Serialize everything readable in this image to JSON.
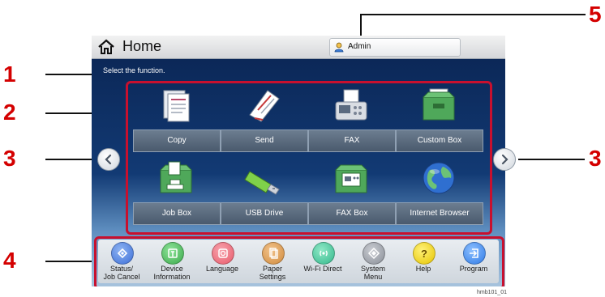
{
  "window": {
    "title": "Home"
  },
  "header": {
    "user_label": "Admin"
  },
  "prompt": "Select the function.",
  "functions": [
    {
      "label": "Copy",
      "icon": "copy-icon"
    },
    {
      "label": "Send",
      "icon": "send-icon"
    },
    {
      "label": "FAX",
      "icon": "fax-icon"
    },
    {
      "label": "Custom Box",
      "icon": "custom-box-icon"
    },
    {
      "label": "Job Box",
      "icon": "job-box-icon"
    },
    {
      "label": "USB Drive",
      "icon": "usb-drive-icon"
    },
    {
      "label": "FAX Box",
      "icon": "fax-box-icon"
    },
    {
      "label": "Internet Browser",
      "icon": "internet-browser-icon"
    }
  ],
  "system_menu": [
    {
      "line1": "Status/",
      "line2": "Job Cancel",
      "icon": "status-icon",
      "color": "#3d6fd8"
    },
    {
      "line1": "Device",
      "line2": "Information",
      "icon": "device-info-icon",
      "color": "#3aa94a"
    },
    {
      "line1": "Language",
      "line2": "",
      "icon": "language-icon",
      "color": "#e85a6a"
    },
    {
      "line1": "Paper",
      "line2": "Settings",
      "icon": "paper-settings-icon",
      "color": "#d08a3c"
    },
    {
      "line1": "Wi-Fi Direct",
      "line2": "",
      "icon": "wifi-direct-icon",
      "color": "#34b88c"
    },
    {
      "line1": "System",
      "line2": "Menu",
      "icon": "system-menu-icon",
      "color": "#8a8f98"
    },
    {
      "line1": "Help",
      "line2": "",
      "icon": "help-icon",
      "color": "#e6c400"
    },
    {
      "line1": "Program",
      "line2": "",
      "icon": "program-icon",
      "color": "#2e7ae6"
    }
  ],
  "callouts": [
    "1",
    "2",
    "3",
    "3",
    "4",
    "5"
  ],
  "figure_code": "hmb101_01",
  "accent_color": "#c8102e"
}
